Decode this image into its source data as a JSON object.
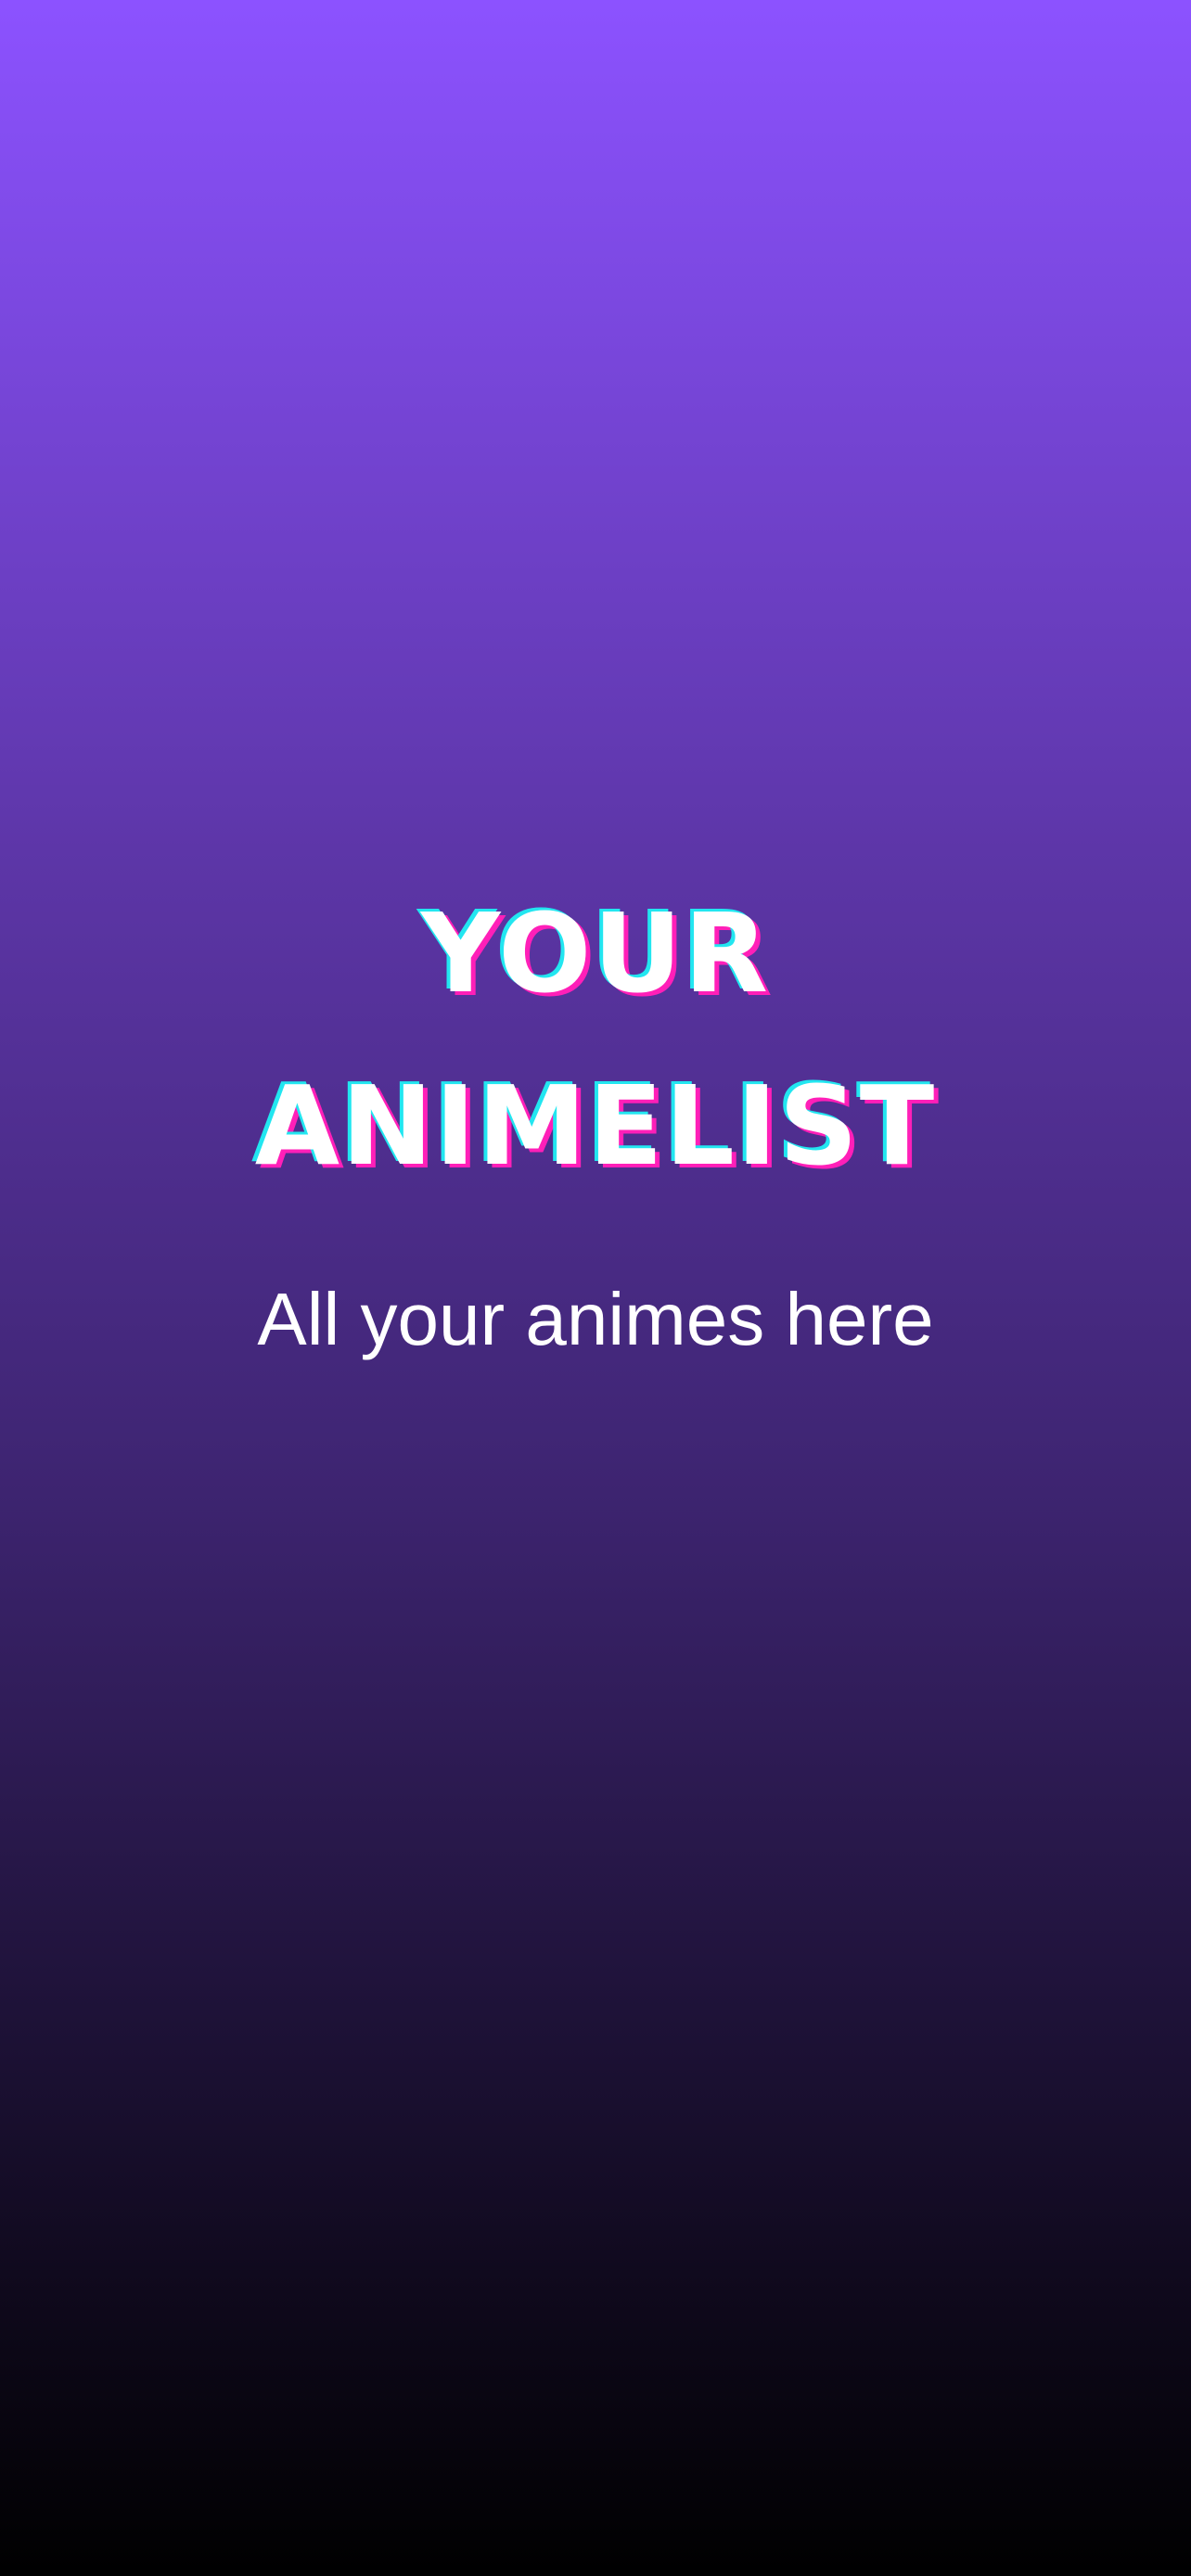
{
  "splash": {
    "title_line_1": "YOUR",
    "title_line_2": "ANIMELIST",
    "subtitle": "All your animes here"
  },
  "colors": {
    "gradient_top": "#8c52ff",
    "gradient_bottom": "#000000",
    "title_text": "#ffffff",
    "title_shadow_cyan": "#22e6f0",
    "title_shadow_magenta": "#ff1fb8",
    "subtitle_text": "#ffffff"
  }
}
